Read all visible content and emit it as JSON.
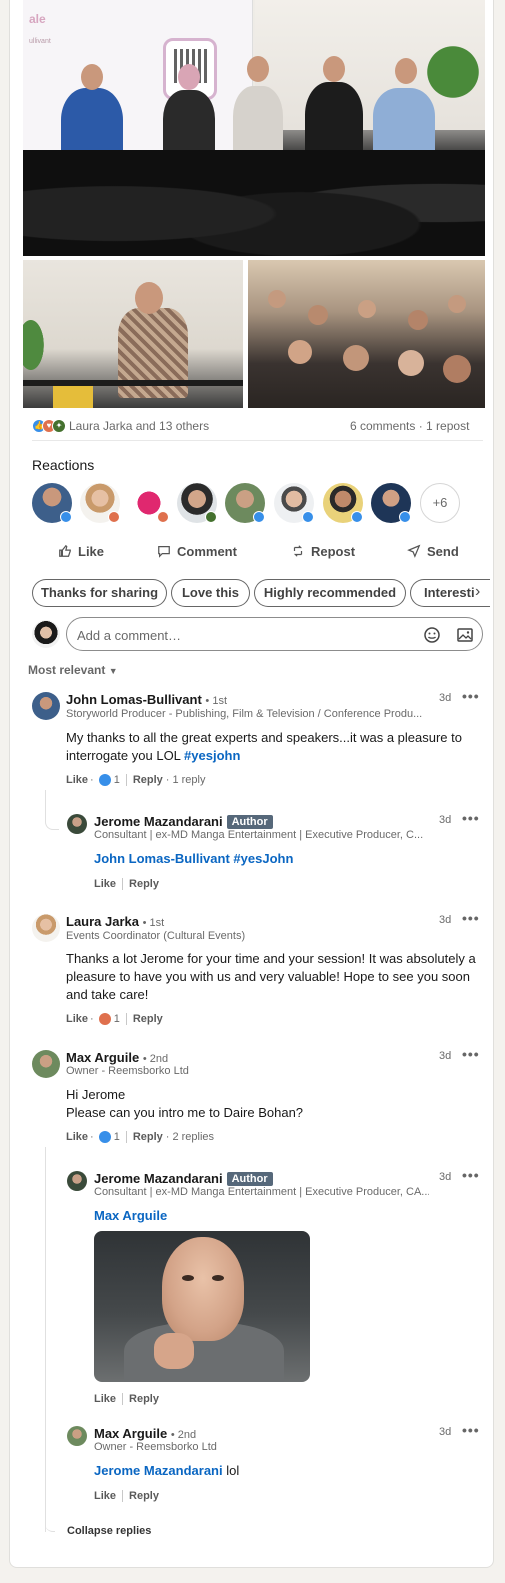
{
  "post": {
    "images": [
      {
        "alt_kind": "panel-photo-main"
      },
      {
        "alt_kind": "speaker-photo"
      },
      {
        "alt_kind": "audience-photo"
      }
    ],
    "screen_text": "ale",
    "screen_subtext": "ullivant",
    "reactions_summary": "Laura Jarka and 13 others",
    "comments_count": "6 comments",
    "reposts_count": "1 repost",
    "separator": "·"
  },
  "reactions": {
    "title": "Reactions",
    "more_label": "+6",
    "badge_colors": {
      "like": "#378fe9",
      "love": "#df704d",
      "celebrate": "#44712e"
    }
  },
  "actions": {
    "like": "Like",
    "comment": "Comment",
    "repost": "Repost",
    "send": "Send"
  },
  "chips": [
    "Thanks for sharing",
    "Love this",
    "Highly recommended",
    "Interesti"
  ],
  "composer": {
    "placeholder": "Add a comment…"
  },
  "sort": {
    "label": "Most relevant"
  },
  "comments": [
    {
      "name": "John Lomas-Bullivant",
      "degree": "• 1st",
      "headline": "Storyworld Producer - Publishing, Film & Television / Conference Produ...",
      "time": "3d",
      "body_text": "My thanks to all the great experts and speakers...it was a pleasure to interrogate you LOL ",
      "body_hashtag": "#yesjohn",
      "like": "Like",
      "reaction_count": "1",
      "reply": "Reply",
      "replies": "1 reply"
    },
    {
      "name": "Jerome Mazandarani",
      "author_tag": "Author",
      "headline": "Consultant | ex-MD Manga Entertainment | Executive Producer, C...",
      "time": "3d",
      "mention": "John Lomas-Bullivant",
      "body_hashtag": "#yesJohn",
      "like": "Like",
      "reply": "Reply"
    },
    {
      "name": "Laura Jarka",
      "degree": "• 1st",
      "headline": "Events Coordinator (Cultural Events)",
      "time": "3d",
      "body_text": "Thanks a lot Jerome for your time and your session! It was absolutely a pleasure to have you with us and very valuable! Hope to see you soon and take care!",
      "like": "Like",
      "reaction_count": "1",
      "reply": "Reply"
    },
    {
      "name": "Max Arguile",
      "degree": "• 2nd",
      "headline": "Owner - Reemsborko Ltd",
      "time": "3d",
      "body_line1": "Hi Jerome",
      "body_line2": "Please can you intro me to Daire Bohan?",
      "like": "Like",
      "reaction_count": "1",
      "reply": "Reply",
      "replies": "2 replies"
    },
    {
      "name": "Jerome Mazandarani",
      "author_tag": "Author",
      "headline": "Consultant | ex-MD Manga Entertainment | Executive Producer, CA...",
      "time": "3d",
      "mention": "Max Arguile",
      "like": "Like",
      "reply": "Reply"
    },
    {
      "name": "Max Arguile",
      "degree": "• 2nd",
      "headline": "Owner - Reemsborko Ltd",
      "time": "3d",
      "mention": "Jerome Mazandarani",
      "body_text": " lol",
      "like": "Like",
      "reply": "Reply"
    }
  ],
  "collapse_label": "Collapse replies",
  "more_icon": "ellipsis-icon"
}
